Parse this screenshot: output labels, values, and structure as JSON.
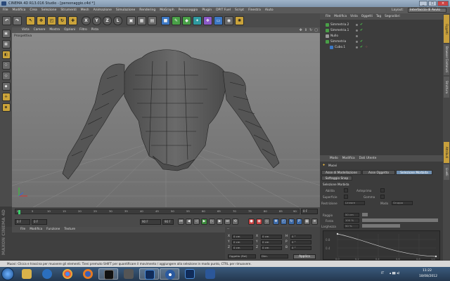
{
  "window": {
    "title": "CINEMA 4D R13.016 Studio - [personaggio.c4d *]",
    "buttons": [
      "_",
      "□",
      "×"
    ]
  },
  "menubar": [
    "File",
    "Modifica",
    "Crea",
    "Selezione",
    "Strumenti",
    "Mesh",
    "Animazione",
    "Simulazione",
    "Rendering",
    "MoGraph",
    "Personaggio",
    "Plugin",
    "DPIT Fuel",
    "Script",
    "Finestra",
    "Aiuto"
  ],
  "layout": {
    "label": "Layout:",
    "value": "Interfaccia di Avvio"
  },
  "toolbar": {
    "undo": "↶",
    "redo": "↷",
    "x": "X",
    "y": "Y",
    "z": "Z",
    "l": "L"
  },
  "viewport": {
    "menu": [
      "Vista",
      "Camere",
      "Mostra",
      "Opzioni",
      "Filtro",
      "Pista"
    ],
    "label": "Prospettiva"
  },
  "timeline": {
    "ticks": [
      "0",
      "5",
      "10",
      "15",
      "20",
      "25",
      "30",
      "35",
      "40",
      "45",
      "50",
      "55",
      "60",
      "65",
      "70",
      "75",
      "80",
      "85",
      "90"
    ],
    "frame": "0 F"
  },
  "playbar": {
    "start": "0 F",
    "current": "0 F",
    "end": "90 F",
    "end2": "90 F"
  },
  "materials": {
    "menu": [
      "File",
      "Modifica",
      "Funzione",
      "Texture"
    ]
  },
  "logo": "MAXON CINEMA 4D",
  "coords": {
    "header": "--",
    "rows": [
      {
        "axis": "X",
        "pos": "0 cm",
        "size": "0 cm",
        "rot_axis": "H",
        "rot": "0 °"
      },
      {
        "axis": "Y",
        "pos": "0 cm",
        "size": "0 cm",
        "rot_axis": "P",
        "rot": "0 °"
      },
      {
        "axis": "Z",
        "pos": "0 cm",
        "size": "0 cm",
        "rot_axis": "B",
        "rot": "0 °"
      }
    ],
    "mode1": "Oggetto (Rel)",
    "mode2": "Dim.",
    "apply": "Applica"
  },
  "objects": {
    "menu": [
      "File",
      "Modifica",
      "Vista",
      "Oggetti",
      "Tag",
      "Segnalibri"
    ],
    "items": [
      {
        "name": "Simmetria.2"
      },
      {
        "name": "Simmetria.1"
      },
      {
        "name": "Nullo"
      },
      {
        "name": "Simmetria"
      },
      {
        "name": "Cubo.1"
      }
    ]
  },
  "attributes": {
    "menu": [
      "Modo",
      "Modifica",
      "Dati Utente"
    ],
    "tool": "Muovi",
    "tabs": [
      "Asse di Modellazione",
      "Asse Oggetto",
      "Selezione Morbida"
    ],
    "tab_row2": "Softaggio Snap",
    "section": "Selezione Morbida",
    "rows": [
      {
        "label": "Abilita",
        "check": "Anteprima"
      },
      {
        "label": "Superficie",
        "check": "Gomma"
      },
      {
        "label": "Restrizione",
        "value": "Lineare",
        "extra_label": "Modo",
        "extra_value": "Gruppo"
      },
      {
        "label": "Raggio",
        "value": "50 cm"
      },
      {
        "label": "Forza",
        "value": "100 %"
      },
      {
        "label": "Larghezza",
        "value": "50 %"
      }
    ],
    "graph_y": [
      "0.8",
      "0.4"
    ],
    "graph_x": [
      "0.0",
      "0.2",
      "0.4",
      "0.6",
      "0.8",
      "1.0"
    ]
  },
  "righttabs": [
    "Oggetti",
    "Browser Contenuti",
    "Struttura",
    "Attributi",
    "Livelli"
  ],
  "status": "Muovi: Clicca e trascina per muovere gli elementi. Tieni premuto SHIFT per quantificare il movimento / aggiungere alla selezione in modo punto, CTRL per rimuovere.",
  "taskbar": {
    "tray": "IT",
    "time": "11:22",
    "date": "18/08/2012"
  },
  "colors": {
    "accent": "#c8a03c",
    "selection": "#6f8fb0",
    "viewport_bg": "#7c7c7c",
    "status_ok": "#4ec94e"
  }
}
